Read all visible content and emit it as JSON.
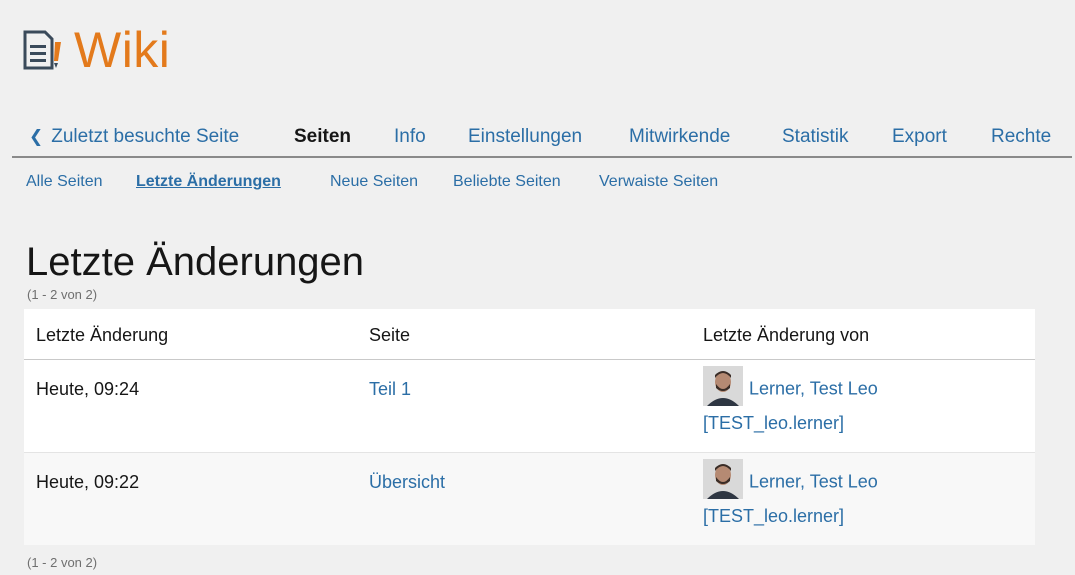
{
  "header": {
    "title": "Wiki",
    "icon": "wiki-icon"
  },
  "tabs": {
    "back": "Zuletzt besuchte Seite",
    "items": [
      "Seiten",
      "Info",
      "Einstellungen",
      "Mitwirkende",
      "Statistik",
      "Export",
      "Rechte"
    ],
    "active": "Seiten"
  },
  "subtabs": {
    "items": [
      "Alle Seiten",
      "Letzte Änderungen",
      "Neue Seiten",
      "Beliebte Seiten",
      "Verwaiste Seiten"
    ],
    "active": "Letzte Änderungen"
  },
  "page": {
    "title": "Letzte Änderungen",
    "count": "(1 - 2 von 2)"
  },
  "table": {
    "columns": [
      "Letzte Änderung",
      "Seite",
      "Letzte Änderung von"
    ],
    "rows": [
      {
        "date": "Heute, 09:24",
        "page": "Teil 1",
        "user": "Lerner, Test Leo",
        "login": "[TEST_leo.lerner]"
      },
      {
        "date": "Heute, 09:22",
        "page": "Übersicht",
        "user": "Lerner, Test Leo",
        "login": "[TEST_leo.lerner]"
      }
    ]
  },
  "colors": {
    "accent": "#e37a1c",
    "link": "#2b6ea6"
  }
}
